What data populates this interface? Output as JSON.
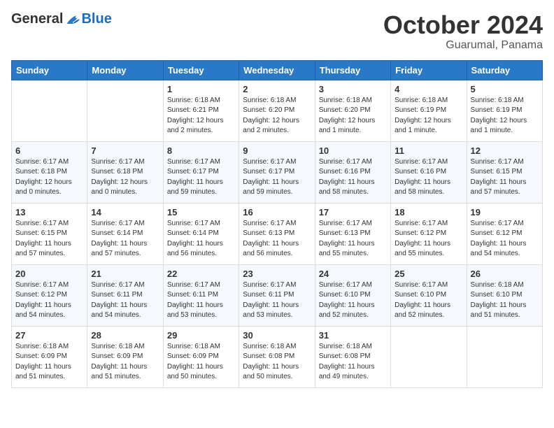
{
  "logo": {
    "general": "General",
    "blue": "Blue"
  },
  "title": "October 2024",
  "subtitle": "Guarumal, Panama",
  "days_of_week": [
    "Sunday",
    "Monday",
    "Tuesday",
    "Wednesday",
    "Thursday",
    "Friday",
    "Saturday"
  ],
  "weeks": [
    [
      {
        "day": "",
        "info": ""
      },
      {
        "day": "",
        "info": ""
      },
      {
        "day": "1",
        "info": "Sunrise: 6:18 AM\nSunset: 6:21 PM\nDaylight: 12 hours\nand 2 minutes."
      },
      {
        "day": "2",
        "info": "Sunrise: 6:18 AM\nSunset: 6:20 PM\nDaylight: 12 hours\nand 2 minutes."
      },
      {
        "day": "3",
        "info": "Sunrise: 6:18 AM\nSunset: 6:20 PM\nDaylight: 12 hours\nand 1 minute."
      },
      {
        "day": "4",
        "info": "Sunrise: 6:18 AM\nSunset: 6:19 PM\nDaylight: 12 hours\nand 1 minute."
      },
      {
        "day": "5",
        "info": "Sunrise: 6:18 AM\nSunset: 6:19 PM\nDaylight: 12 hours\nand 1 minute."
      }
    ],
    [
      {
        "day": "6",
        "info": "Sunrise: 6:17 AM\nSunset: 6:18 PM\nDaylight: 12 hours\nand 0 minutes."
      },
      {
        "day": "7",
        "info": "Sunrise: 6:17 AM\nSunset: 6:18 PM\nDaylight: 12 hours\nand 0 minutes."
      },
      {
        "day": "8",
        "info": "Sunrise: 6:17 AM\nSunset: 6:17 PM\nDaylight: 11 hours\nand 59 minutes."
      },
      {
        "day": "9",
        "info": "Sunrise: 6:17 AM\nSunset: 6:17 PM\nDaylight: 11 hours\nand 59 minutes."
      },
      {
        "day": "10",
        "info": "Sunrise: 6:17 AM\nSunset: 6:16 PM\nDaylight: 11 hours\nand 58 minutes."
      },
      {
        "day": "11",
        "info": "Sunrise: 6:17 AM\nSunset: 6:16 PM\nDaylight: 11 hours\nand 58 minutes."
      },
      {
        "day": "12",
        "info": "Sunrise: 6:17 AM\nSunset: 6:15 PM\nDaylight: 11 hours\nand 57 minutes."
      }
    ],
    [
      {
        "day": "13",
        "info": "Sunrise: 6:17 AM\nSunset: 6:15 PM\nDaylight: 11 hours\nand 57 minutes."
      },
      {
        "day": "14",
        "info": "Sunrise: 6:17 AM\nSunset: 6:14 PM\nDaylight: 11 hours\nand 57 minutes."
      },
      {
        "day": "15",
        "info": "Sunrise: 6:17 AM\nSunset: 6:14 PM\nDaylight: 11 hours\nand 56 minutes."
      },
      {
        "day": "16",
        "info": "Sunrise: 6:17 AM\nSunset: 6:13 PM\nDaylight: 11 hours\nand 56 minutes."
      },
      {
        "day": "17",
        "info": "Sunrise: 6:17 AM\nSunset: 6:13 PM\nDaylight: 11 hours\nand 55 minutes."
      },
      {
        "day": "18",
        "info": "Sunrise: 6:17 AM\nSunset: 6:12 PM\nDaylight: 11 hours\nand 55 minutes."
      },
      {
        "day": "19",
        "info": "Sunrise: 6:17 AM\nSunset: 6:12 PM\nDaylight: 11 hours\nand 54 minutes."
      }
    ],
    [
      {
        "day": "20",
        "info": "Sunrise: 6:17 AM\nSunset: 6:12 PM\nDaylight: 11 hours\nand 54 minutes."
      },
      {
        "day": "21",
        "info": "Sunrise: 6:17 AM\nSunset: 6:11 PM\nDaylight: 11 hours\nand 54 minutes."
      },
      {
        "day": "22",
        "info": "Sunrise: 6:17 AM\nSunset: 6:11 PM\nDaylight: 11 hours\nand 53 minutes."
      },
      {
        "day": "23",
        "info": "Sunrise: 6:17 AM\nSunset: 6:11 PM\nDaylight: 11 hours\nand 53 minutes."
      },
      {
        "day": "24",
        "info": "Sunrise: 6:17 AM\nSunset: 6:10 PM\nDaylight: 11 hours\nand 52 minutes."
      },
      {
        "day": "25",
        "info": "Sunrise: 6:17 AM\nSunset: 6:10 PM\nDaylight: 11 hours\nand 52 minutes."
      },
      {
        "day": "26",
        "info": "Sunrise: 6:18 AM\nSunset: 6:10 PM\nDaylight: 11 hours\nand 51 minutes."
      }
    ],
    [
      {
        "day": "27",
        "info": "Sunrise: 6:18 AM\nSunset: 6:09 PM\nDaylight: 11 hours\nand 51 minutes."
      },
      {
        "day": "28",
        "info": "Sunrise: 6:18 AM\nSunset: 6:09 PM\nDaylight: 11 hours\nand 51 minutes."
      },
      {
        "day": "29",
        "info": "Sunrise: 6:18 AM\nSunset: 6:09 PM\nDaylight: 11 hours\nand 50 minutes."
      },
      {
        "day": "30",
        "info": "Sunrise: 6:18 AM\nSunset: 6:08 PM\nDaylight: 11 hours\nand 50 minutes."
      },
      {
        "day": "31",
        "info": "Sunrise: 6:18 AM\nSunset: 6:08 PM\nDaylight: 11 hours\nand 49 minutes."
      },
      {
        "day": "",
        "info": ""
      },
      {
        "day": "",
        "info": ""
      }
    ]
  ]
}
